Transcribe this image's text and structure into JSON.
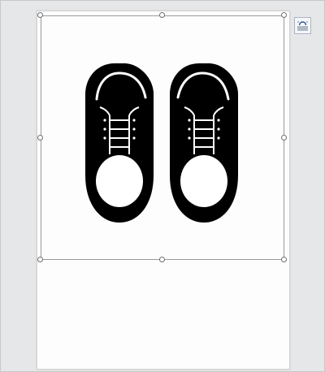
{
  "document": {
    "image": {
      "icon": "shoes-icon",
      "fill_color": "#000000"
    },
    "layout_options": {
      "icon": "layout-options-icon"
    }
  },
  "colors": {
    "workspace": "#e6e7e8",
    "page": "#fcfdfc",
    "selection_border": "#9a9a9a",
    "accent": "#2b579a"
  }
}
